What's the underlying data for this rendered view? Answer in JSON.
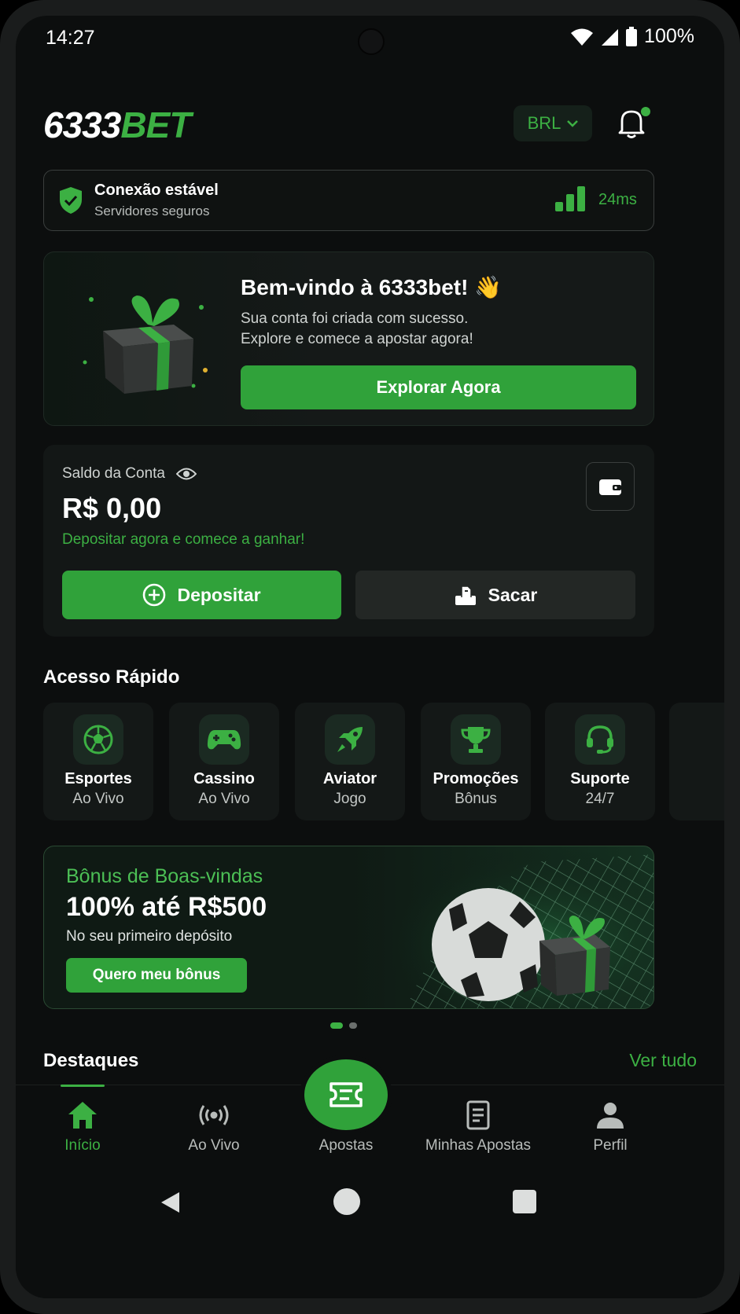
{
  "status_bar": {
    "time": "14:27",
    "battery": "100%"
  },
  "header": {
    "logo_white": "6333",
    "logo_green": "BET",
    "currency": "BRL"
  },
  "connection": {
    "title": "Conexão estável",
    "subtitle": "Servidores seguros",
    "latency": "24ms"
  },
  "welcome": {
    "title": "Bem-vindo à 6333bet! 👋",
    "line1": "Sua conta foi criada com sucesso.",
    "line2": "Explore e comece a apostar agora!",
    "button": "Explorar Agora"
  },
  "balance": {
    "label": "Saldo da Conta",
    "amount": "R$ 0,00",
    "cta": "Depositar agora e comece a ganhar!",
    "deposit": "Depositar",
    "withdraw": "Sacar"
  },
  "quick_access": {
    "title": "Acesso Rápido",
    "items": [
      {
        "name": "Esportes",
        "sub": "Ao Vivo",
        "icon": "soccer-ball-icon"
      },
      {
        "name": "Cassino",
        "sub": "Ao Vivo",
        "icon": "gamepad-icon"
      },
      {
        "name": "Aviator",
        "sub": "Jogo",
        "icon": "rocket-icon"
      },
      {
        "name": "Promoções",
        "sub": "Bônus",
        "icon": "trophy-icon"
      },
      {
        "name": "Suporte",
        "sub": "24/7",
        "icon": "headset-icon"
      }
    ]
  },
  "promo": {
    "title": "Bônus de Boas-vindas",
    "headline": "100% até R$500",
    "sub": "No seu primeiro depósito",
    "button": "Quero meu bônus"
  },
  "highlights": {
    "title": "Destaques",
    "see_all": "Ver tudo"
  },
  "bottom_nav": {
    "items": [
      {
        "label": "Início",
        "icon": "home-icon"
      },
      {
        "label": "Ao Vivo",
        "icon": "live-icon"
      },
      {
        "label": "Apostas",
        "icon": "ticket-icon"
      },
      {
        "label": "Minhas Apostas",
        "icon": "document-icon"
      },
      {
        "label": "Perfil",
        "icon": "user-icon"
      }
    ]
  },
  "colors": {
    "accent": "#3cb043",
    "background": "#0c0e0e",
    "card": "#131716"
  }
}
